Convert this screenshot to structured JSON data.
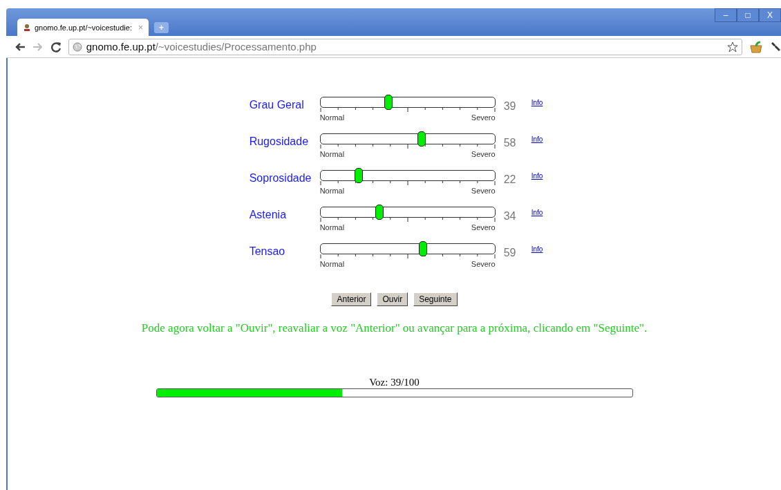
{
  "browser": {
    "tab_title": "gnomo.fe.up.pt/~voicestudie:",
    "tab_close": "×",
    "new_tab": "+",
    "window_buttons": [
      "–",
      "□",
      "X"
    ],
    "address_host": "gnomo.fe.up.pt",
    "address_path": "/~voicestudies/Processamento.php"
  },
  "scales": [
    {
      "name": "Grau Geral",
      "level": 0.39,
      "reading": "39",
      "min_label": "Normal",
      "max_label": "Severo",
      "info": "Info"
    },
    {
      "name": "Rugosidade",
      "level": 0.58,
      "reading": "58",
      "min_label": "Normal",
      "max_label": "Severo",
      "info": "Info"
    },
    {
      "name": "Soprosidade",
      "level": 0.22,
      "reading": "22",
      "min_label": "Normal",
      "max_label": "Severo",
      "info": "Info"
    },
    {
      "name": "Astenia",
      "level": 0.34,
      "reading": "34",
      "min_label": "Normal",
      "max_label": "Severo",
      "info": "Info"
    },
    {
      "name": "Tensao",
      "level": 0.59,
      "reading": "59",
      "min_label": "Normal",
      "max_label": "Severo",
      "info": "Info"
    }
  ],
  "buttons": [
    "Anterior",
    "Ouvir",
    "Seguinte"
  ],
  "message": "Pode agora voltar a \"Ouvir\", reavaliar a voz \"Anterior\" ou avançar para a próxima, clicando em \"Seguinte\".",
  "progress": {
    "label": "Voz: 39/100",
    "level": 0.39
  }
}
